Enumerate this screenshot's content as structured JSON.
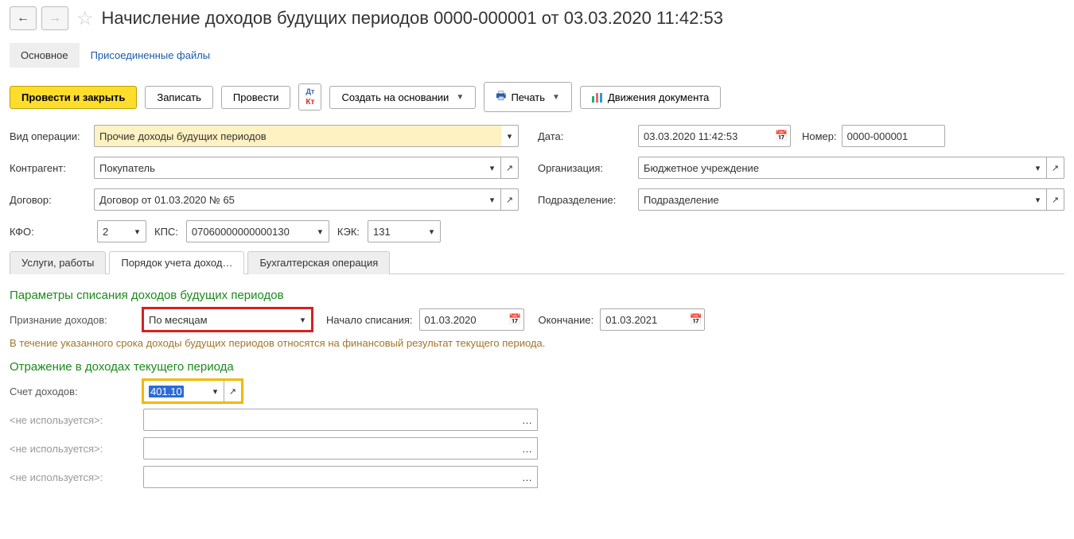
{
  "header": {
    "title": "Начисление доходов будущих периодов 0000-000001 от 03.03.2020 11:42:53"
  },
  "subtabs": {
    "main": "Основное",
    "files": "Присоединенные файлы"
  },
  "toolbar": {
    "post_close": "Провести и закрыть",
    "save": "Записать",
    "post": "Провести",
    "create_based": "Создать на основании",
    "print": "Печать",
    "movements": "Движения документа"
  },
  "labels": {
    "op_type": "Вид операции:",
    "date": "Дата:",
    "number": "Номер:",
    "counterparty": "Контрагент:",
    "organization": "Организация:",
    "contract": "Договор:",
    "department": "Подразделение:",
    "kfo": "КФО:",
    "kps": "КПС:",
    "kek": "КЭК:"
  },
  "values": {
    "op_type": "Прочие доходы будущих периодов",
    "date": "03.03.2020 11:42:53",
    "number": "0000-000001",
    "counterparty": "Покупатель",
    "organization": "Бюджетное учреждение",
    "contract": "Договор от 01.03.2020 № 65",
    "department": "Подразделение",
    "kfo": "2",
    "kps": "07060000000000130",
    "kek": "131"
  },
  "tabs": {
    "services": "Услуги, работы",
    "order": "Порядок учета доход…",
    "accounting": "Бухгалтерская операция"
  },
  "section": {
    "params_title": "Параметры списания доходов будущих периодов",
    "recognition_label": "Признание доходов:",
    "recognition_value": "По месяцам",
    "start_label": "Начало списания:",
    "start_value": "01.03.2020",
    "end_label": "Окончание:",
    "end_value": "01.03.2021",
    "hint": "В течение указанного срока доходы будущих периодов относятся на финансовый результат текущего периода.",
    "reflection_title": "Отражение в доходах текущего периода",
    "account_label": "Счет доходов:",
    "account_value": "401.10",
    "unused": "<не используется>:"
  }
}
